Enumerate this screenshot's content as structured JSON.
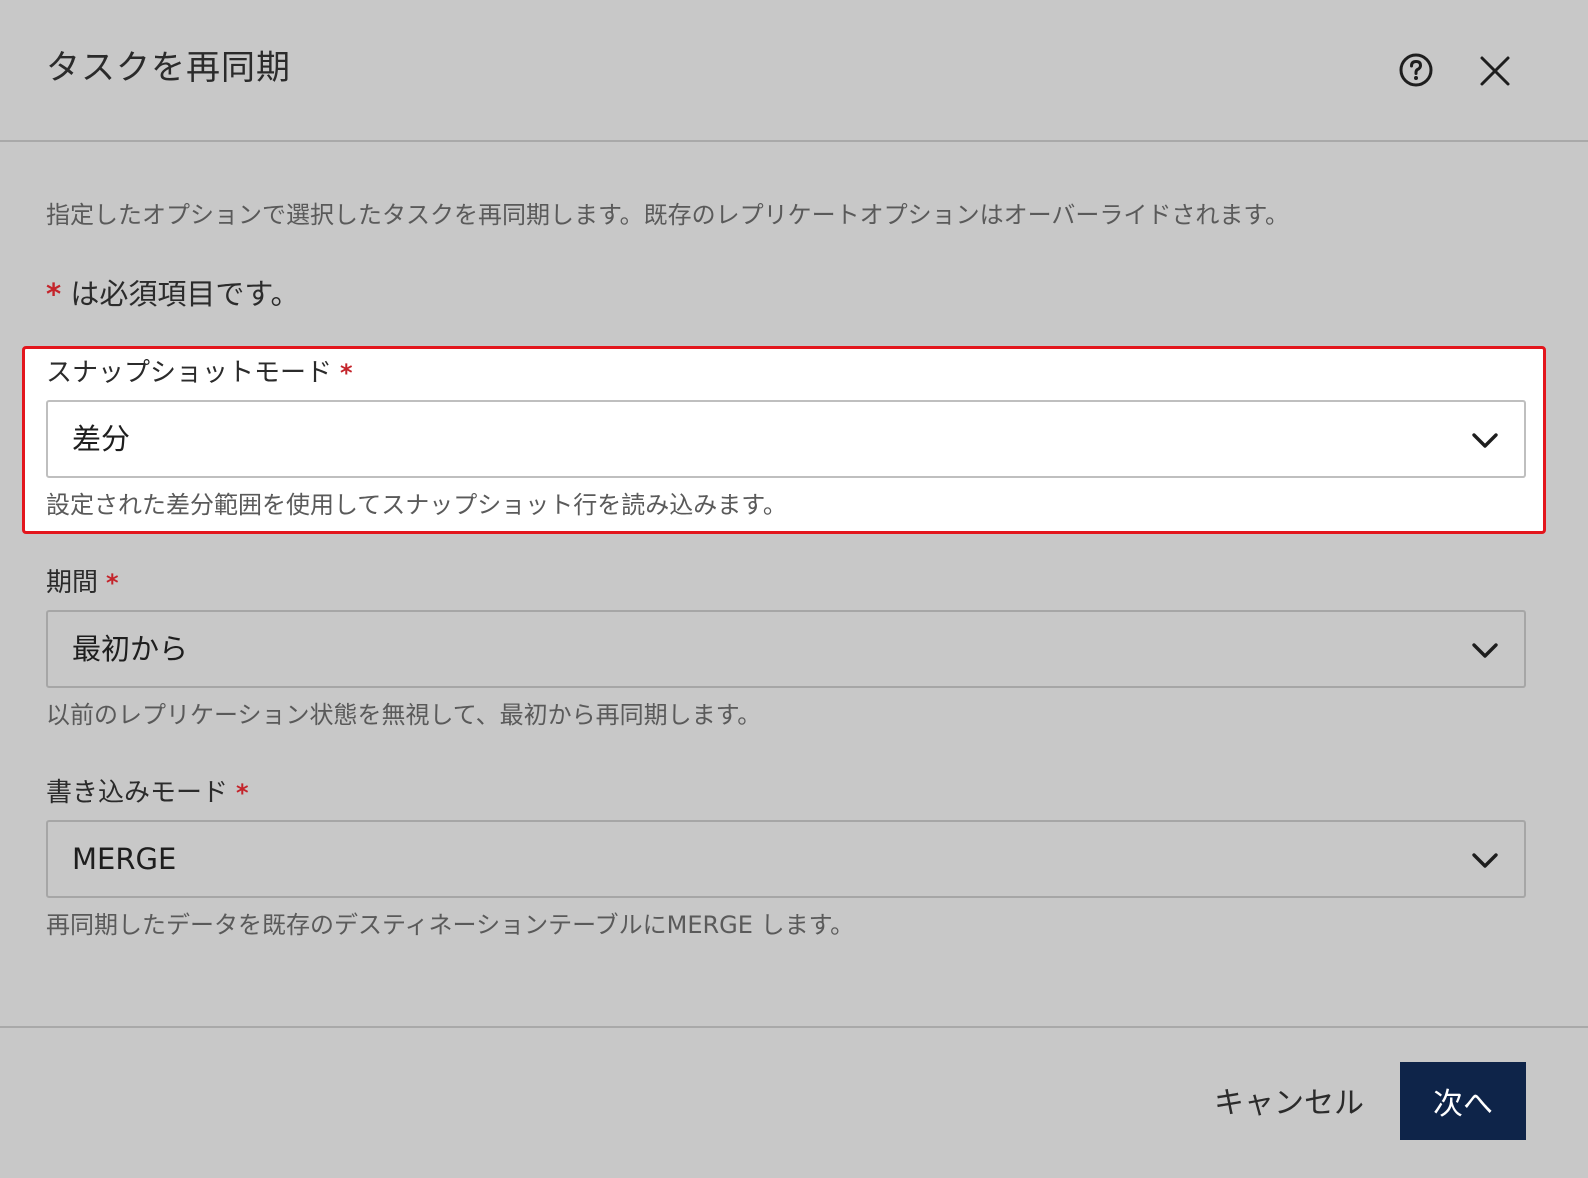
{
  "dialog": {
    "title": "タスクを再同期",
    "help_icon": "help-circle-icon",
    "close_icon": "close-icon"
  },
  "body": {
    "description": "指定したオプションで選択したタスクを再同期します。既存のレプリケートオプションはオーバーライドされます。",
    "required_asterisk": "*",
    "required_note": " は必須項目です。"
  },
  "fields": {
    "snapshot_mode": {
      "label": "スナップショットモード",
      "required": "*",
      "value": "差分",
      "hint": "設定された差分範囲を使用してスナップショット行を読み込みます。"
    },
    "period": {
      "label": "期間",
      "required": "*",
      "value": "最初から",
      "hint": "以前のレプリケーション状態を無視して、最初から再同期します。"
    },
    "write_mode": {
      "label": "書き込みモード",
      "required": "*",
      "value": "MERGE",
      "hint": "再同期したデータを既存のデスティネーションテーブルにMERGE します。"
    }
  },
  "footer": {
    "cancel_label": "キャンセル",
    "next_label": "次へ"
  },
  "colors": {
    "overlay_background": "#c8c8c8",
    "highlight_border": "#e3161d",
    "required_asterisk": "#c4242b",
    "primary_button": "#0e2449"
  }
}
